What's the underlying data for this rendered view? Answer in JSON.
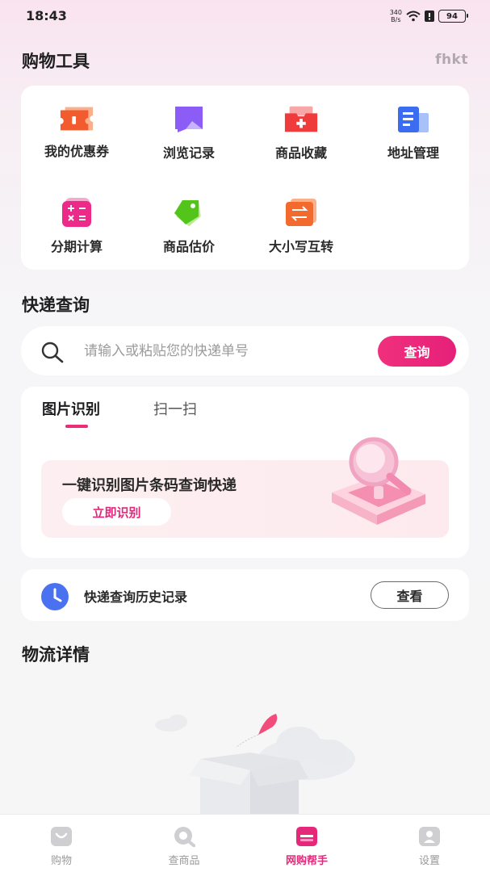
{
  "status_bar": {
    "time": "18:43",
    "net_speed_value": "340",
    "net_speed_unit": "B/s",
    "battery": "94"
  },
  "shopping_tools": {
    "title": "购物工具",
    "brand": "fhkt",
    "items": [
      {
        "label": "我的优惠券",
        "icon": "coupon-icon",
        "color": "#f25b2e"
      },
      {
        "label": "浏览记录",
        "icon": "browse-history-icon",
        "color": "#8b5cf6"
      },
      {
        "label": "商品收藏",
        "icon": "favorites-icon",
        "color": "#ef3b3b"
      },
      {
        "label": "地址管理",
        "icon": "address-icon",
        "color": "#3b6df0"
      },
      {
        "label": "分期计算",
        "icon": "calculator-icon",
        "color": "#ec2a8a"
      },
      {
        "label": "商品估价",
        "icon": "price-tag-icon",
        "color": "#52c41a"
      },
      {
        "label": "大小写互转",
        "icon": "convert-icon",
        "color": "#f26a2e"
      }
    ]
  },
  "express": {
    "title": "快递查询",
    "placeholder": "请输入或粘贴您的快递单号",
    "search_button": "查询",
    "tabs": [
      {
        "label": "图片识别",
        "active": true
      },
      {
        "label": "扫一扫",
        "active": false
      }
    ],
    "recognize_title": "一键识别图片条码查询快递",
    "recognize_button": "立即识别",
    "history_label": "快递查询历史记录",
    "history_button": "查看"
  },
  "logistics": {
    "title": "物流详情"
  },
  "bottom_nav": [
    {
      "label": "购物",
      "icon": "shopping-bag-icon",
      "active": false
    },
    {
      "label": "查商品",
      "icon": "search-product-icon",
      "active": false
    },
    {
      "label": "网购帮手",
      "icon": "helper-icon",
      "active": true
    },
    {
      "label": "设置",
      "icon": "settings-user-icon",
      "active": false
    }
  ],
  "colors": {
    "accent": "#e6287a",
    "background": "#f6f6f7",
    "card": "#ffffff"
  }
}
